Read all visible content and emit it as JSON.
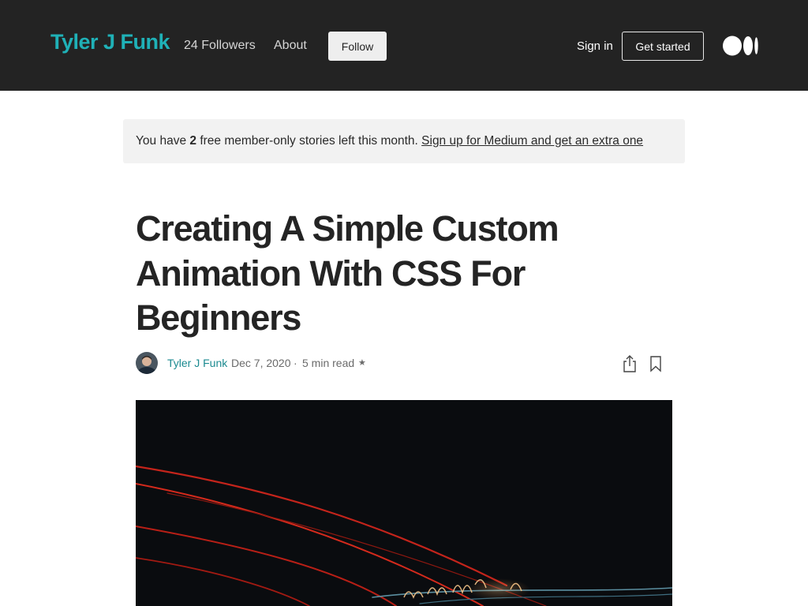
{
  "header": {
    "brand": "Tyler J Funk",
    "followers": "24 Followers",
    "about": "About",
    "follow": "Follow",
    "sign_in": "Sign in",
    "get_started": "Get started",
    "logo_icon": "medium-logo-icon"
  },
  "banner": {
    "prefix": "You have ",
    "count": "2",
    "middle": " free member-only stories left this month. ",
    "link": "Sign up for Medium and get an extra one"
  },
  "article": {
    "title": "Creating A Simple Custom Animation With CSS For Beginners",
    "author": "Tyler J Funk",
    "date": "Dec 7, 2020",
    "separator": "·",
    "read_time": "5 min read",
    "star": "★",
    "share_icon": "share-icon",
    "bookmark_icon": "bookmark-icon"
  },
  "colors": {
    "header_bg": "#232323",
    "brand": "#1fb1b7",
    "author_link": "#1b8a90",
    "banner_bg": "#f2f2f2"
  }
}
